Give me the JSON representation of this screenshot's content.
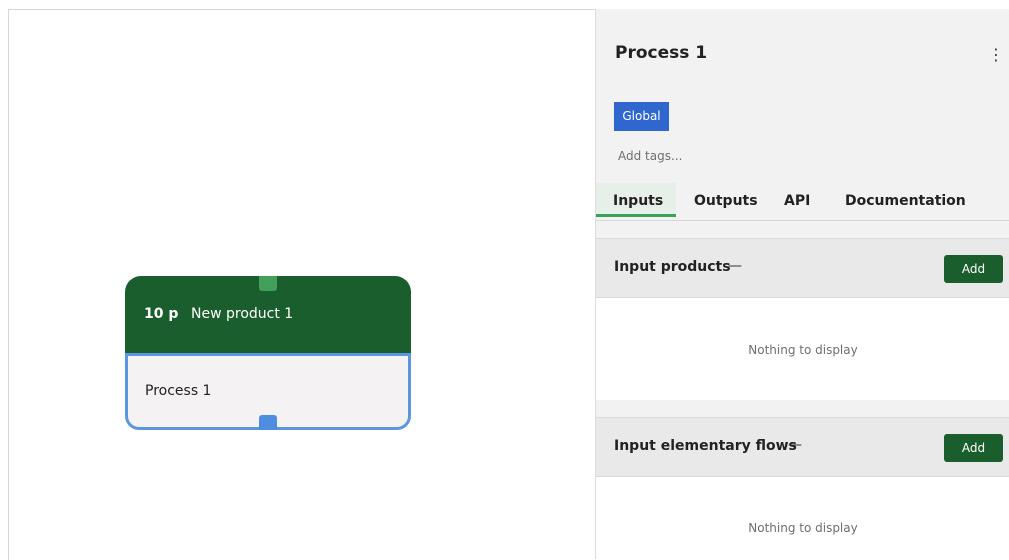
{
  "canvas": {
    "node": {
      "quantity": "10 p",
      "product": "New product 1",
      "title": "Process 1"
    }
  },
  "panel": {
    "title": "Process 1",
    "menu_icon": "⋮",
    "tag": "Global",
    "tags_placeholder": "Add tags...",
    "tabs": [
      {
        "label": "Inputs",
        "active": true
      },
      {
        "label": "Outputs",
        "active": false
      },
      {
        "label": "API",
        "active": false
      },
      {
        "label": "Documentation",
        "active": false
      }
    ],
    "sections": [
      {
        "title": "Input products",
        "dash": "—",
        "add_label": "Add",
        "empty_text": "Nothing to display"
      },
      {
        "title": "Input elementary flows",
        "dash": "—",
        "add_label": "Add",
        "empty_text": "Nothing to display"
      }
    ]
  },
  "colors": {
    "node_top": "#1b5e2e",
    "node_border": "#5c96e0",
    "global_tag": "#2f67cf",
    "add_button": "#1b5e2e",
    "active_tab_underline": "#3aa15a"
  }
}
